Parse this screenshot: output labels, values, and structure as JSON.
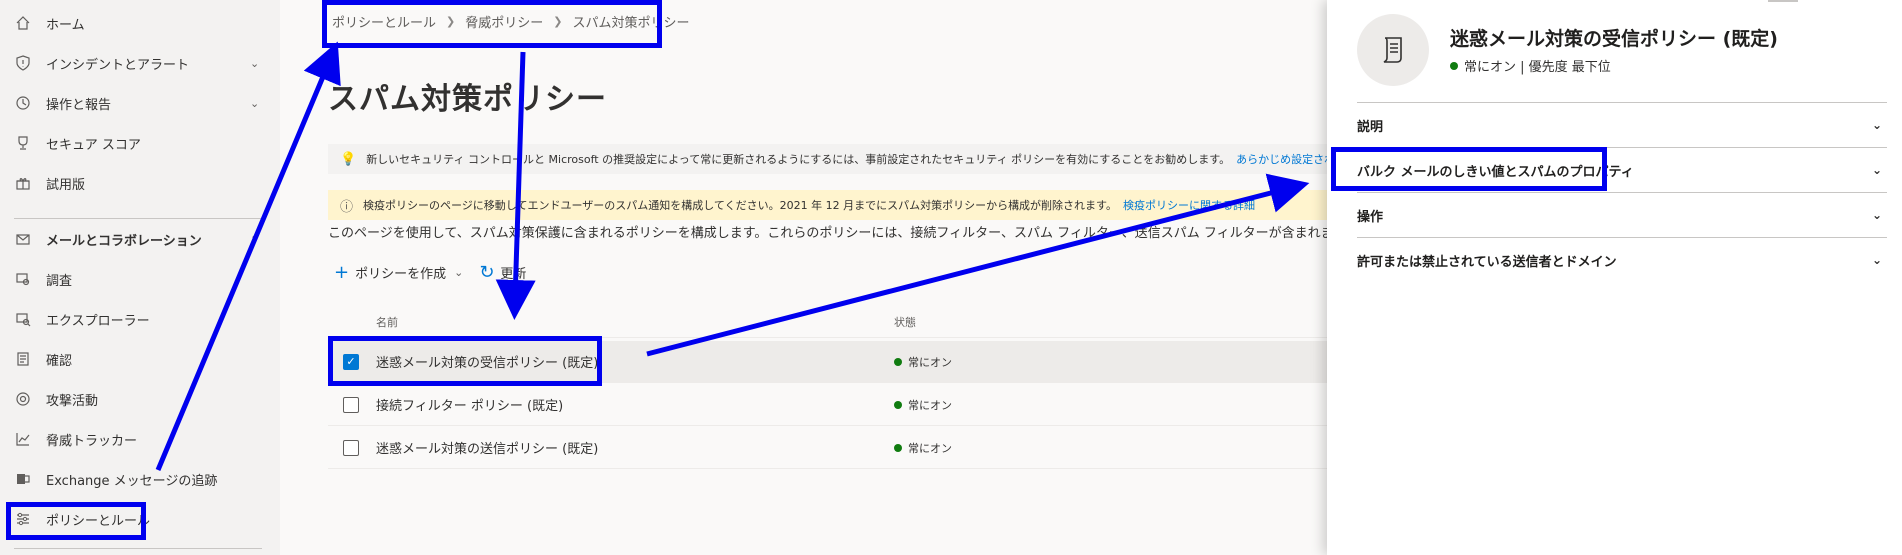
{
  "sidebar": {
    "items": [
      {
        "label": "ホーム",
        "icon": "home-icon"
      },
      {
        "label": "インシデントとアラート",
        "icon": "shield-icon"
      },
      {
        "label": "操作と報告",
        "icon": "history-icon"
      },
      {
        "label": "セキュア スコア",
        "icon": "trophy-icon"
      },
      {
        "label": "試用版",
        "icon": "gift-icon"
      },
      {
        "label": "メールとコラボレーション",
        "icon": "mail-icon"
      },
      {
        "label": "調査",
        "icon": "investigation-icon"
      },
      {
        "label": "エクスプローラー",
        "icon": "explorer-icon"
      },
      {
        "label": "確認",
        "icon": "review-icon"
      },
      {
        "label": "攻撃活動",
        "icon": "campaign-icon"
      },
      {
        "label": "脅威トラッカー",
        "icon": "chart-icon"
      },
      {
        "label": "Exchange メッセージの追跡",
        "icon": "exchange-icon"
      },
      {
        "label": "ポリシーとルール",
        "icon": "sliders-icon"
      }
    ]
  },
  "breadcrumb": [
    "ポリシーとルール",
    "脅威ポリシー",
    "スパム対策ポリシー"
  ],
  "page_title": "スパム対策ポリシー",
  "info_bar": {
    "text": "新しいセキュリティ コントロールと Microsoft の推奨設定によって常に更新されるようにするには、事前設定されたセキュリティ ポリシーを有効にすることをお勧めします。",
    "link": "あらかじめ設定されたセキュリティ ポリシーを"
  },
  "warning_bar": {
    "text": "検疫ポリシーのページに移動してエンドユーザーのスパム通知を構成してください。2021 年 12 月までにスパム対策ポリシーから構成が削除されます。",
    "link": "検疫ポリシーに関する詳細"
  },
  "description": "このページを使用して、スパム対策保護に含まれるポリシーを構成します。これらのポリシーには、接続フィルター、スパム フィルター、送信スパム フィルターが含まれます。詳",
  "commands": {
    "create": "ポリシーを作成",
    "refresh": "更新"
  },
  "table": {
    "columns": [
      "名前",
      "状態"
    ],
    "rows": [
      {
        "name": "迷惑メール対策の受信ポリシー (既定)",
        "status": "常にオン",
        "selected": true
      },
      {
        "name": "接続フィルター ポリシー (既定)",
        "status": "常にオン",
        "selected": false
      },
      {
        "name": "迷惑メール対策の送信ポリシー (既定)",
        "status": "常にオン",
        "selected": false
      }
    ]
  },
  "flyout": {
    "title": "迷惑メール対策の受信ポリシー (既定)",
    "subtitle": "常にオン | 優先度 最下位",
    "sections": [
      "説明",
      "バルク メールのしきい値とスパムのプロパティ",
      "操作",
      "許可または禁止されている送信者とドメイン"
    ]
  },
  "colors": {
    "accent": "#0078d4",
    "annotation": "#0000ee",
    "status": "#107c10"
  }
}
